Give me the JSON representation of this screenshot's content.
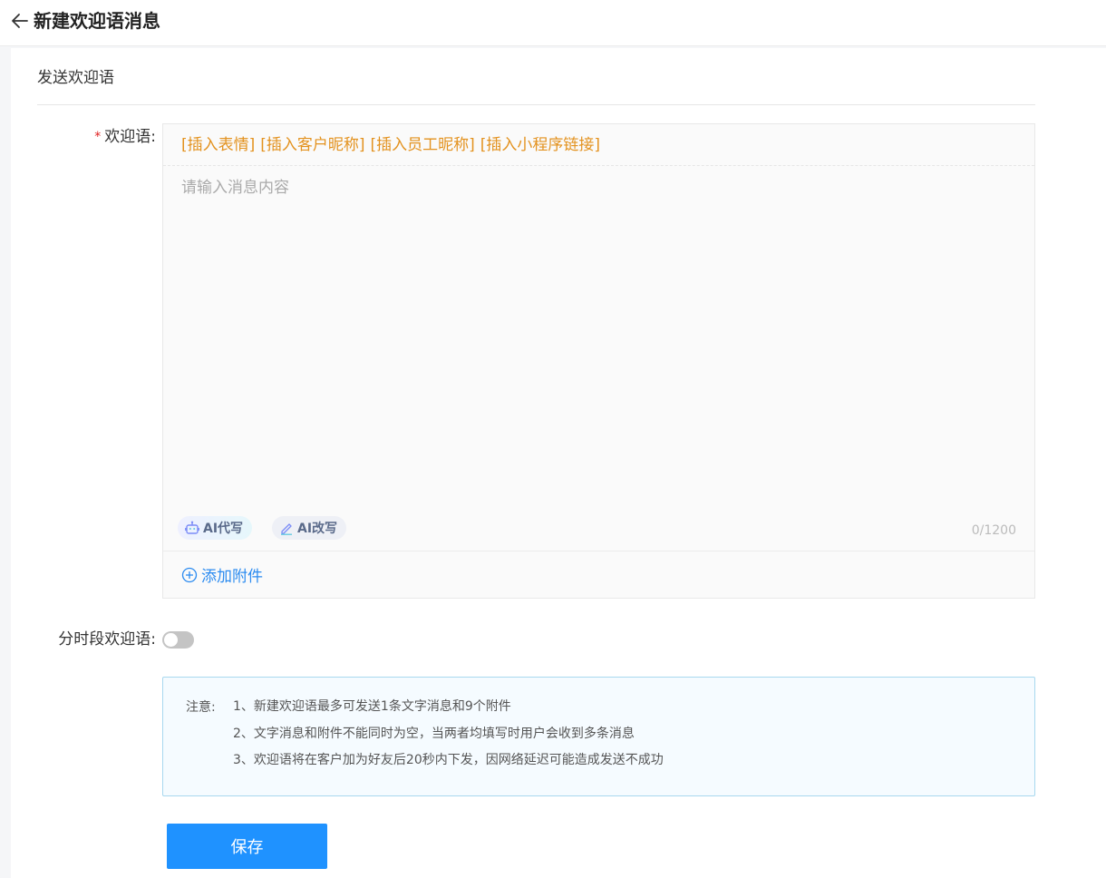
{
  "header": {
    "title": "新建欢迎语消息"
  },
  "section": {
    "title": "发送欢迎语"
  },
  "form": {
    "welcome_label": "欢迎语:",
    "required_mark": "*",
    "insert_links": [
      "[插入表情]",
      "[插入客户昵称]",
      "[插入员工昵称]",
      "[插入小程序链接]"
    ],
    "message_placeholder": "请输入消息内容",
    "message_value": "",
    "ai_write_label": "AI代写",
    "ai_rewrite_label": "AI改写",
    "char_count": "0/1200",
    "attach_label": "添加附件",
    "timed_label": "分时段欢迎语:",
    "timed_enabled": false
  },
  "notice": {
    "label": "注意:",
    "lines": [
      "1、新建欢迎语最多可发送1条文字消息和9个附件",
      "2、文字消息和附件不能同时为空，当两者均填写时用户会收到多条消息",
      "3、欢迎语将在客户加为好友后20秒内下发，因网络延迟可能造成发送不成功"
    ]
  },
  "actions": {
    "save_label": "保存"
  },
  "colors": {
    "accent": "#1f92ff",
    "insert_link": "#e3921f",
    "attach_link": "#2d8cf0"
  }
}
